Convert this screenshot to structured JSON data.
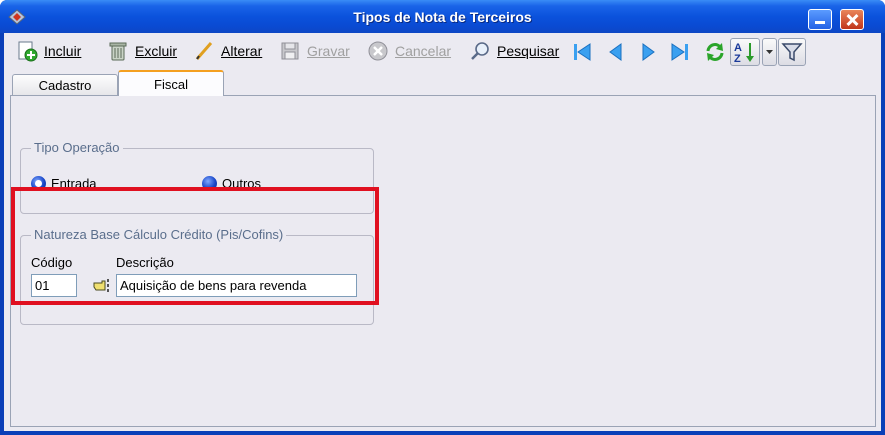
{
  "window": {
    "title": "Tipos de Nota de Terceiros"
  },
  "toolbar": {
    "incluir": "Incluir",
    "excluir": "Excluir",
    "alterar": "Alterar",
    "gravar": "Gravar",
    "cancelar": "Cancelar",
    "pesquisar": "Pesquisar"
  },
  "tabs": [
    {
      "label": "Cadastro",
      "active": false
    },
    {
      "label": "Fiscal",
      "active": true
    }
  ],
  "tipo_operacao": {
    "title": "Tipo Operação",
    "options": [
      {
        "label": "Entrada",
        "selected": true
      },
      {
        "label": "Outros",
        "selected": false
      }
    ]
  },
  "natureza": {
    "title": "Natureza Base Cálculo Crédito (Pis/Cofins)",
    "codigo_label": "Código",
    "descricao_label": "Descrição",
    "codigo_value": "01",
    "descricao_value": "Aquisição de bens para revenda"
  },
  "colors": {
    "highlight": "#e01020",
    "titlebar": "#0b52dc",
    "accent_tab": "#f4a020"
  }
}
